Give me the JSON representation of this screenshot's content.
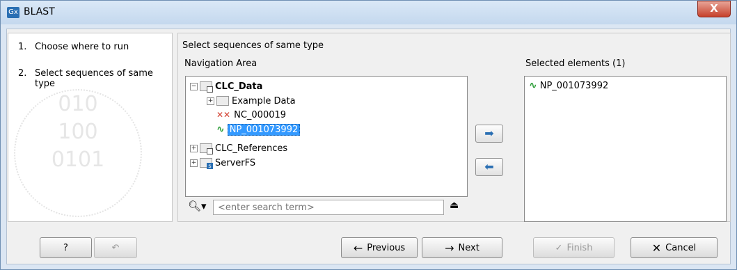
{
  "window": {
    "title": "BLAST",
    "app_icon": "Gx",
    "close": "X"
  },
  "steps": [
    {
      "num": "1.",
      "label": "Choose where to run"
    },
    {
      "num": "2.",
      "label": "Select sequences of same type"
    }
  ],
  "main": {
    "heading": "Select sequences of same type",
    "nav_label": "Navigation Area",
    "selected_label": "Selected elements (1)",
    "tree": {
      "root": "CLC_Data",
      "example": "Example Data",
      "seq1": "NC_000019",
      "seq2": "NP_001073992",
      "refs": "CLC_References",
      "server": "ServerFS"
    },
    "search": {
      "placeholder": "<enter search term>"
    },
    "selected_items": [
      "NP_001073992"
    ]
  },
  "buttons": {
    "help": "?",
    "previous": "Previous",
    "next": "Next",
    "finish": "Finish",
    "cancel": "Cancel"
  }
}
